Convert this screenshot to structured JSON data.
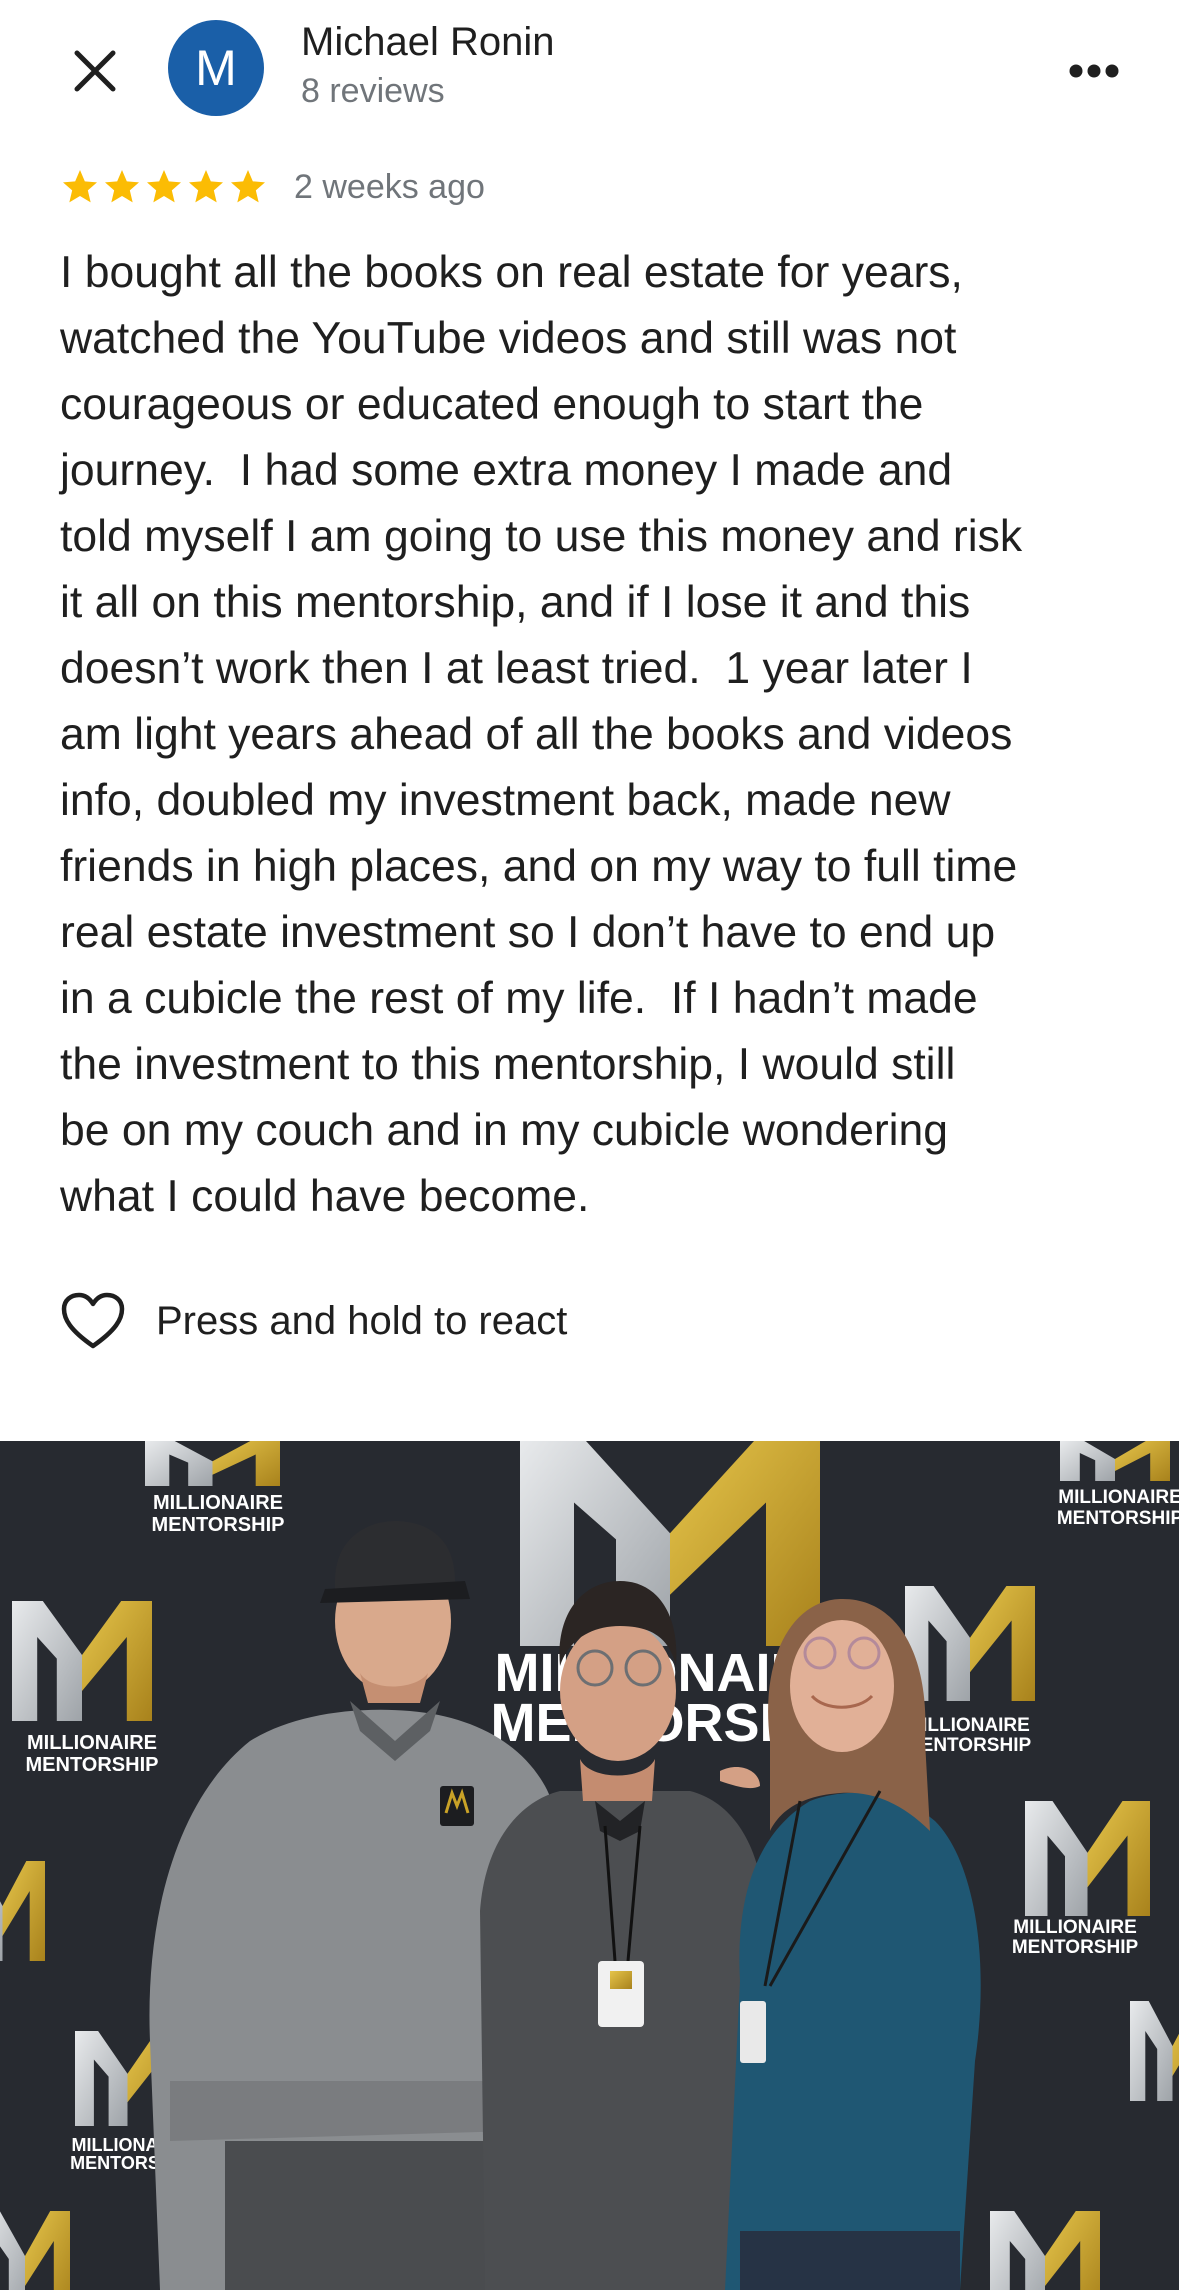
{
  "reviewer": {
    "name": "Michael Ronin",
    "reviews_count": "8 reviews",
    "avatar_letter": "M",
    "avatar_color": "#1a5fa8"
  },
  "icons": {
    "close": "close-icon",
    "more": "more-vert-icon",
    "heart": "heart-outline-icon",
    "star": "star-icon"
  },
  "review": {
    "rating": 5,
    "star_color": "#fbbc04",
    "date": "2 weeks ago",
    "text": "I bought all the books on real estate for years,\nwatched the YouTube videos and still was not\ncourageous or educated enough to start the\njourney.  I had some extra money I made and\ntold myself I am going to use this money and risk\nit all on this mentorship, and if I lose it and this\ndoesn’t work then I at least tried.  1 year later I\nam light years ahead of all the books and videos\ninfo, doubled my investment back, made new\nfriends in high places, and on my way to full time\nreal estate investment so I don’t have to end up\nin a cubicle the rest of my life.  If I hadn’t made\nthe investment to this mentorship, I would still\nbe on my couch and in my cubicle wondering\nwhat I could have become."
  },
  "reaction": {
    "label": "Press and hold to react"
  },
  "photo": {
    "backdrop_brand": "MILLIONAIRE MENTORSHIP",
    "backdrop_brand_line1": "MILLIONAIRE",
    "backdrop_brand_line2": "MENTORSHIP",
    "accent_gold": "#c9a227",
    "accent_silver": "#c8ccd0"
  }
}
